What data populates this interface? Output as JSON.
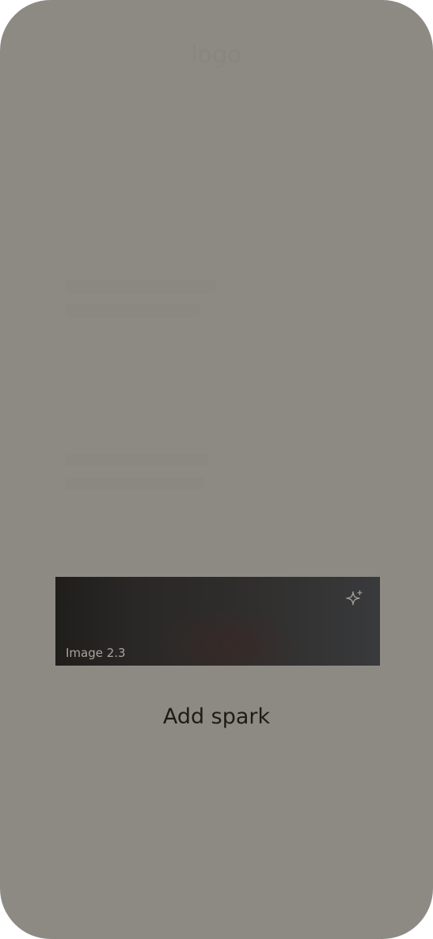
{
  "header": {
    "logo_text": "logo"
  },
  "media": {
    "label": "Image 2.3",
    "icon": "sparkle-icon"
  },
  "actions": {
    "add_spark_label": "Add spark"
  }
}
